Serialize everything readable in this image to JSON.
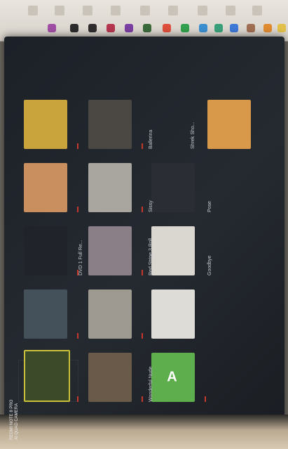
{
  "photo": {
    "description_visible_text": [
      "REDMI NOTE 8 PRO",
      "AI QUAD CAMERA"
    ]
  },
  "screen": {
    "tiles": [
      {
        "label": "Ballerina",
        "color": "#b7a58e"
      },
      {
        "label": "Sissy",
        "color": "#b9a07c"
      },
      {
        "label": "Red Stripe 3 Roll",
        "color": "#8d8e92"
      },
      {
        "label": "Goodbye",
        "color": "#5e6a54"
      },
      {
        "label": "Wonderful Nude",
        "color": "#c7b6a0"
      },
      {
        "label": "Pose",
        "color": "#8e8f7d"
      },
      {
        "label": "Shrek Sho...",
        "color": "#c78f5b"
      },
      {
        "label": "DVD 1 Full Re...",
        "color": "#55524f"
      }
    ],
    "letter_tile": "A"
  },
  "colors": {
    "accent_dash": "#c4392b",
    "screen_bg": "#1f232a",
    "green_tile": "#5fae4e",
    "selection_border": "#c9c13a"
  }
}
